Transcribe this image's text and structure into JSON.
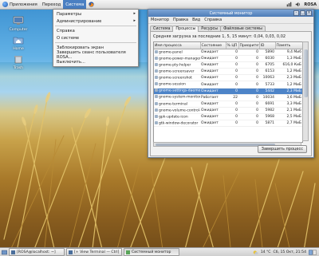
{
  "top_panel": {
    "applications_label": "Приложения",
    "places_label": "Переход",
    "system_label": "Система",
    "user_label": "ROSA"
  },
  "desktop_icons": [
    {
      "label": "Computer",
      "icon": "computer-icon"
    },
    {
      "label": "Home",
      "icon": "home-folder-icon"
    },
    {
      "label": "Trash",
      "icon": "trash-icon"
    }
  ],
  "system_menu": {
    "items": [
      {
        "label": "Параметры",
        "submenu": true
      },
      {
        "label": "Администрирование",
        "submenu": true
      },
      {
        "label": "Справка",
        "submenu": false
      },
      {
        "label": "О системе",
        "submenu": false
      },
      {
        "label": "Заблокировать экран",
        "submenu": false
      },
      {
        "label": "Завершить сеанс пользователя ROSA...",
        "submenu": false
      },
      {
        "label": "Выключить...",
        "submenu": false
      }
    ]
  },
  "monitor_window": {
    "title": "Системный монитор",
    "menu": [
      "Монитор",
      "Правка",
      "Вид",
      "Справка"
    ],
    "tabs": [
      "Система",
      "Процессы",
      "Ресурсы",
      "Файловые системы"
    ],
    "active_tab": "Процессы",
    "load_text": "Средняя загрузка за последние 1, 5, 15 минут: 0,04, 0,03, 0,02",
    "columns": [
      "Имя процесса",
      "Состояние",
      "% ЦП",
      "Приоритет",
      "ID",
      "Память"
    ],
    "rows": [
      [
        "gnome-panel",
        "Ожидает",
        "0",
        "0",
        "5890",
        "9,4 Миб"
      ],
      [
        "gnome-power-manager",
        "Ожидает",
        "0",
        "0",
        "6030",
        "1,3 МиБ"
      ],
      [
        "gnome-pty-helper",
        "Ожидает",
        "0",
        "0",
        "6705",
        "616,0 КиБ"
      ],
      [
        "gnome-screensaver",
        "Ожидает",
        "0",
        "0",
        "6153",
        "1,2 МиБ"
      ],
      [
        "gnome-screenshot",
        "Ожидает",
        "0",
        "0",
        "10063",
        "2,3 МиБ"
      ],
      [
        "gnome-session",
        "Ожидает",
        "0",
        "0",
        "5733",
        "1,2 МиБ"
      ],
      [
        "gnome-settings-daemon",
        "Ожидает",
        "0",
        "0",
        "5442",
        "2,3 МиБ"
      ],
      [
        "gnome-system-monitor",
        "Работает",
        "22",
        "0",
        "10034",
        "3,6 МиБ"
      ],
      [
        "gnome-terminal",
        "Ожидает",
        "0",
        "0",
        "6691",
        "3,3 МиБ"
      ],
      [
        "gnome-volume-control-ap",
        "Ожидает",
        "0",
        "0",
        "5982",
        "2,1 МиБ"
      ],
      [
        "gpk-update-icon",
        "Ожидает",
        "0",
        "0",
        "5968",
        "2,5 МиБ"
      ],
      [
        "gtk-window-decorator",
        "Ожидает",
        "0",
        "0",
        "5871",
        "2,7 МиБ"
      ]
    ],
    "selected_row": 6,
    "end_process_label": "Завершить процесс"
  },
  "bottom_panel": {
    "tasks": [
      {
        "label": "[ROSA@localhost: ~]",
        "active": false
      },
      {
        "label": "[+ View Terminal — Ctrl]",
        "active": false
      },
      {
        "label": "Системный монитор",
        "active": true
      }
    ],
    "temperature": "14 °C",
    "date_time": "Сб, 15 Окт, 21:54"
  },
  "colors": {
    "selection": "#4d84c8",
    "title_bar": "#5b88c2",
    "menu_highlight": "#4a7fc2"
  }
}
